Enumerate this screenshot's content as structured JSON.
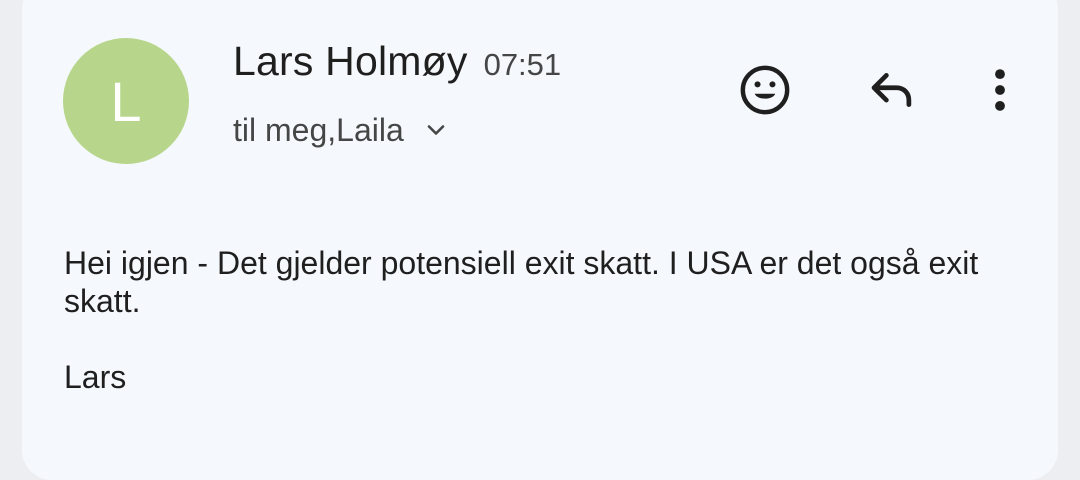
{
  "message": {
    "avatar_letter": "L",
    "avatar_color": "#b7d68b",
    "sender_name": "Lars Holmøy",
    "time": "07:51",
    "recipients": "til meg,Laila",
    "recipients_icon": "chevron-down-icon",
    "actions": [
      {
        "name": "add-reaction",
        "icon": "emoji-icon"
      },
      {
        "name": "reply",
        "icon": "reply-icon"
      },
      {
        "name": "more-options",
        "icon": "more-vert-icon"
      }
    ],
    "body_paragraph": "Hei igjen - Det gjelder potensiell exit skatt. I USA er det også exit skatt.",
    "signature": "Lars"
  },
  "colors": {
    "background": "#eceef2",
    "card": "#f5f8fd",
    "text_primary": "#1f1f1f",
    "text_secondary": "#444746"
  }
}
